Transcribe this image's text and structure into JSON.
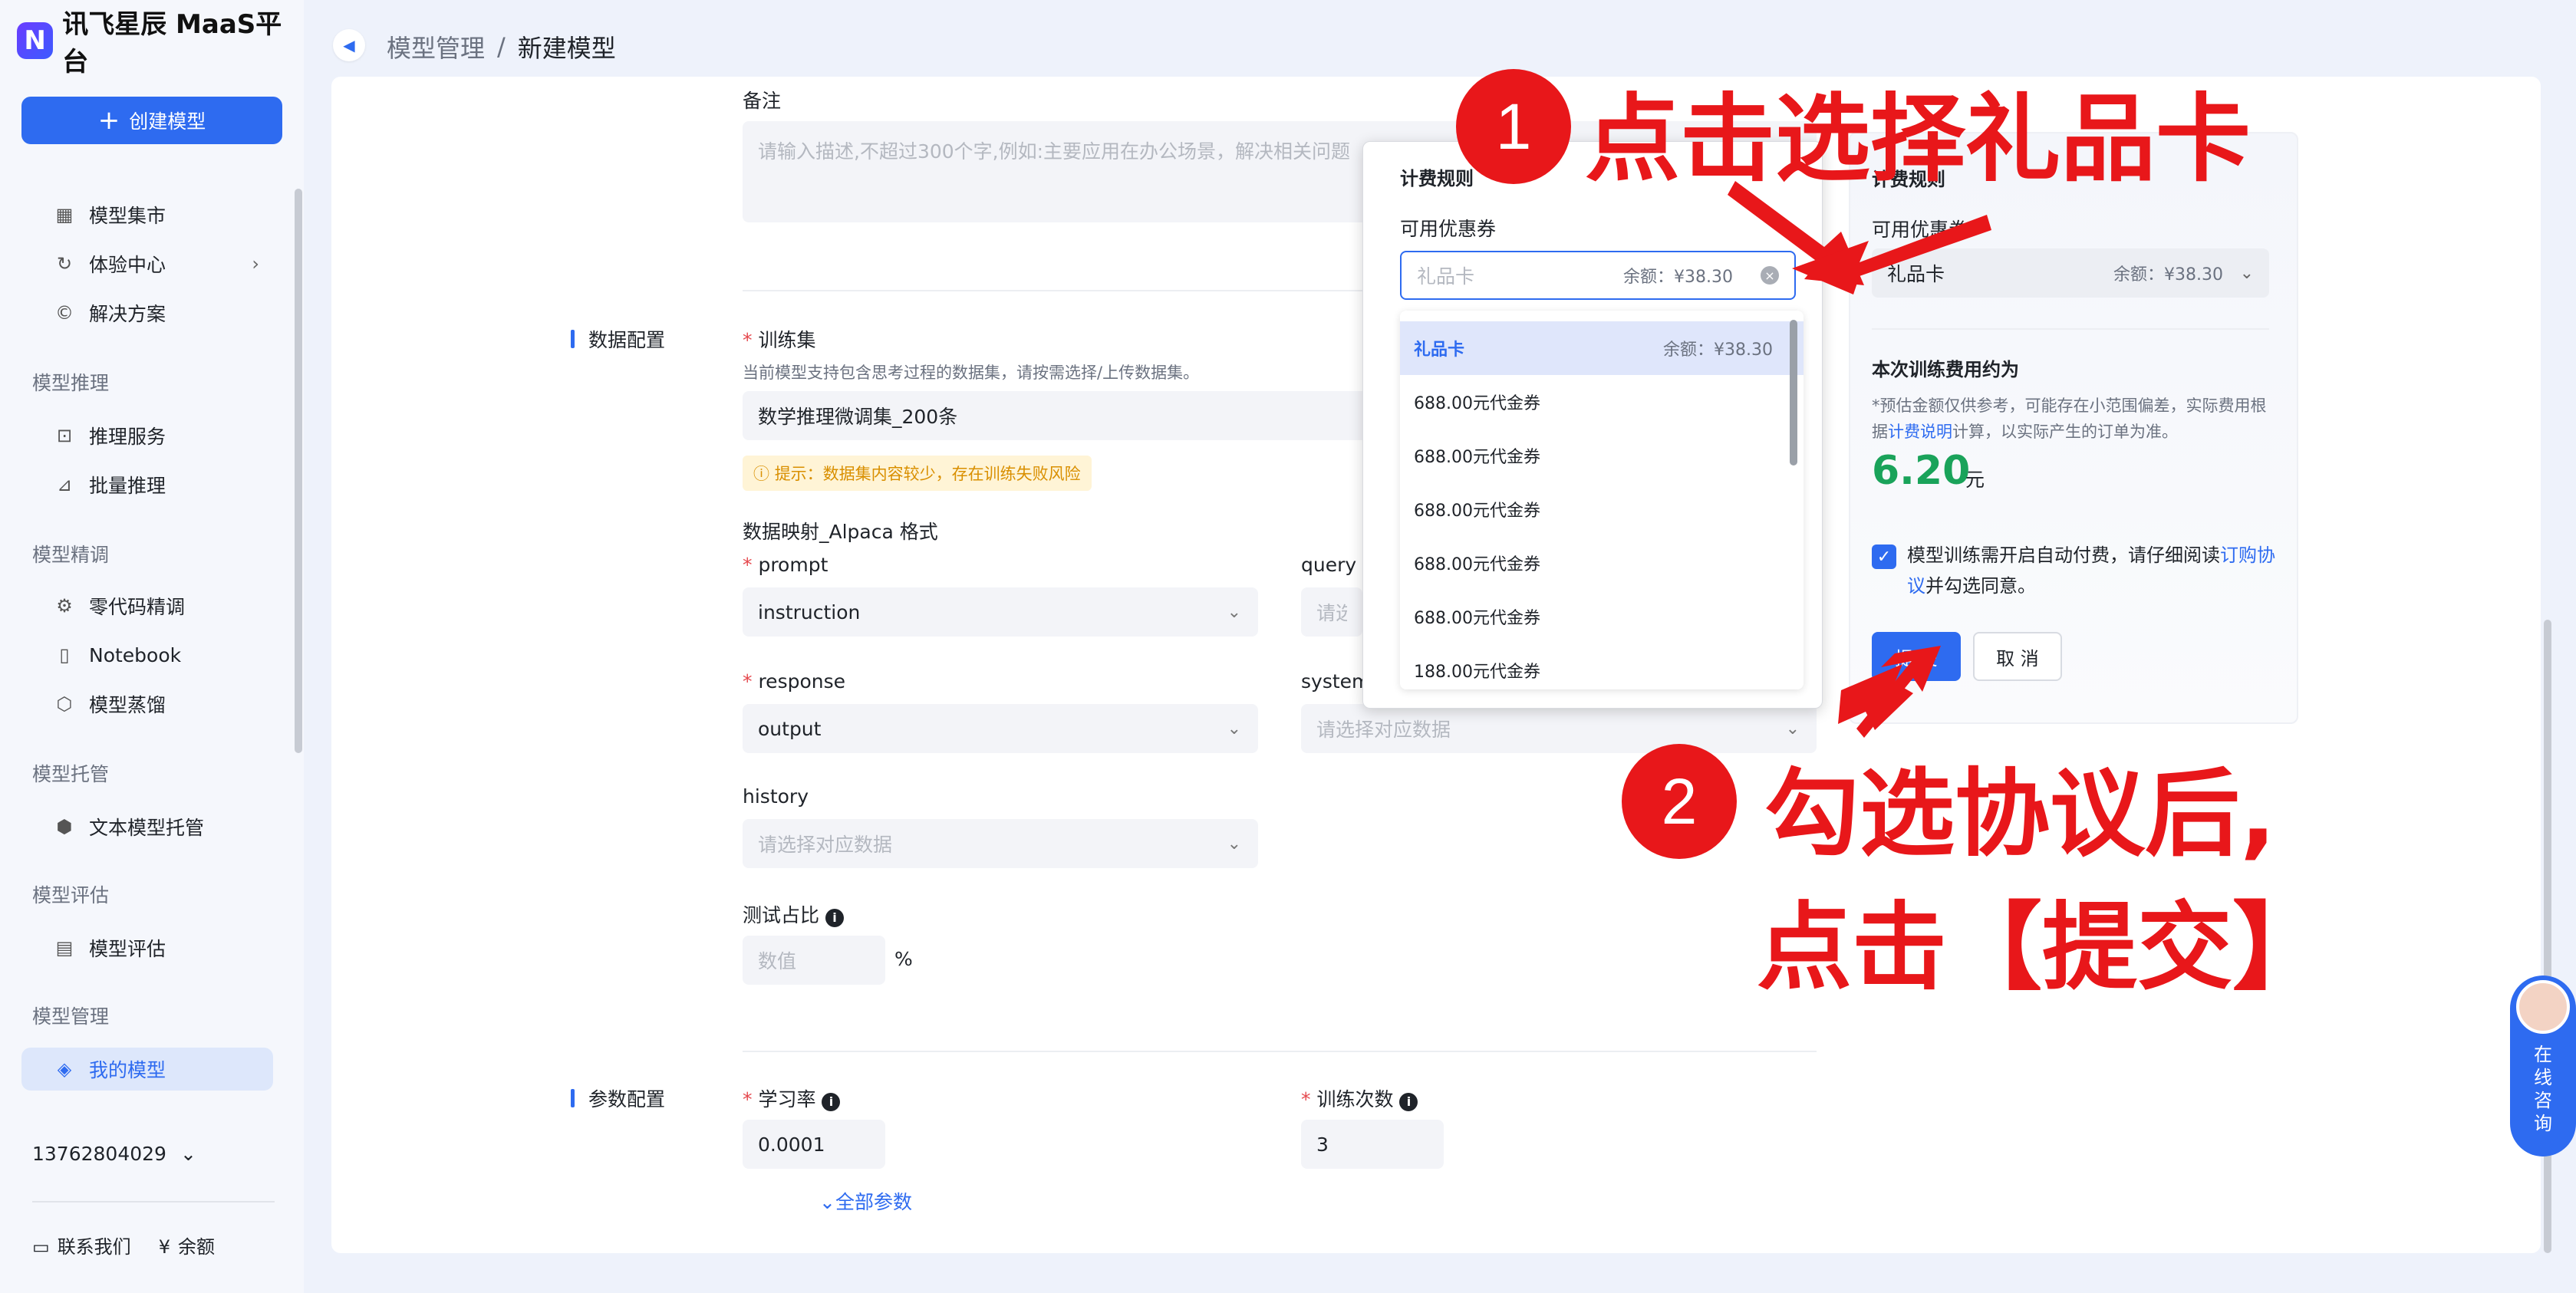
{
  "app": {
    "logo_mark": "N",
    "title": "讯飞星辰 MaaS平台"
  },
  "sidebar": {
    "create_button": "创建模型",
    "top_items": [
      {
        "label": "模型集市",
        "icon": "grid-icon"
      },
      {
        "label": "体验中心",
        "icon": "refresh-icon"
      },
      {
        "label": "解决方案",
        "icon": "copyright-icon"
      }
    ],
    "groups": [
      {
        "title": "模型推理",
        "items": [
          {
            "label": "推理服务"
          },
          {
            "label": "批量推理"
          }
        ]
      },
      {
        "title": "模型精调",
        "items": [
          {
            "label": "零代码精调"
          },
          {
            "label": "Notebook"
          },
          {
            "label": "模型蒸馏"
          }
        ]
      },
      {
        "title": "模型托管",
        "items": [
          {
            "label": "文本模型托管"
          }
        ]
      },
      {
        "title": "模型评估",
        "items": [
          {
            "label": "模型评估"
          }
        ]
      },
      {
        "title": "模型管理",
        "items": [
          {
            "label": "我的模型"
          }
        ]
      }
    ],
    "user": "13762804029",
    "bottom_links": [
      "联系我们",
      "余额"
    ]
  },
  "header": {
    "breadcrumb_parent": "模型管理",
    "breadcrumb_sep": "/",
    "breadcrumb_current": "新建模型"
  },
  "form": {
    "remark_label": "备注",
    "remark_placeholder": "请输入描述,不超过300个字,例如:主要应用在办公场景，解决相关问题",
    "data_section": "数据配置",
    "trainset_label": "训练集",
    "trainset_hint": "当前模型支持包含思考过程的数据集，请按需选择/上传数据集。",
    "trainset_value": "数学推理微调集_200条",
    "trainset_warning": "提示：数据集内容较少，存在训练失败风险",
    "mapping_title": "数据映射_Alpaca 格式",
    "prompt_label": "prompt",
    "prompt_value": "instruction",
    "query_label": "query",
    "query_placeholder": "请选择对应数据",
    "response_label": "response",
    "response_value": "output",
    "system_label": "system",
    "system_placeholder": "请选择对应数据",
    "history_label": "history",
    "history_placeholder": "请选择对应数据",
    "test_ratio_label": "测试占比",
    "test_ratio_placeholder": "数值",
    "test_ratio_unit": "%",
    "param_section": "参数配置",
    "lr_label": "学习率",
    "lr_value": "0.0001",
    "epochs_label": "训练次数",
    "epochs_value": "3",
    "all_params_link": "全部参数"
  },
  "cost_card": {
    "title": "计费规则",
    "coupon_label": "可用优惠券",
    "coupon_value": "礼品卡",
    "coupon_balance": "余额：¥38.30",
    "estimate_title": "本次训练费用约为",
    "estimate_note_pre": "*预估金额仅供参考，可能存在小范围偏差，实际费用根据",
    "estimate_note_link": "计费说明",
    "estimate_note_post": "计算，以实际产生的订单为准。",
    "amount": "6.20",
    "amount_unit": "元",
    "agree_pre": "模型训练需开启自动付费，请仔细阅读",
    "agree_link": "订购协议",
    "agree_post": "并勾选同意。",
    "submit": "提 交",
    "cancel": "取 消"
  },
  "popup": {
    "title": "计费规则",
    "coupon_label": "可用优惠券",
    "input_placeholder": "礼品卡",
    "input_balance": "余额：¥38.30",
    "options": [
      {
        "label": "礼品卡",
        "balance": "余额：¥38.30",
        "selected": true
      },
      {
        "label": "688.00元代金券"
      },
      {
        "label": "688.00元代金券"
      },
      {
        "label": "688.00元代金券"
      },
      {
        "label": "688.00元代金券"
      },
      {
        "label": "688.00元代金券"
      },
      {
        "label": "188.00元代金券"
      }
    ]
  },
  "annotations": {
    "step1_num": "1",
    "step1_text": "点击选择礼品卡",
    "step2_num": "2",
    "step2_line1": "勾选协议后,",
    "step2_line2": "点击【提交】"
  },
  "consult": {
    "label": "在线咨询"
  },
  "colors": {
    "accent": "#2e6bf0",
    "annotation_red": "#e8171a",
    "amount_green": "#1aa35a",
    "warning": "#d98f00"
  }
}
